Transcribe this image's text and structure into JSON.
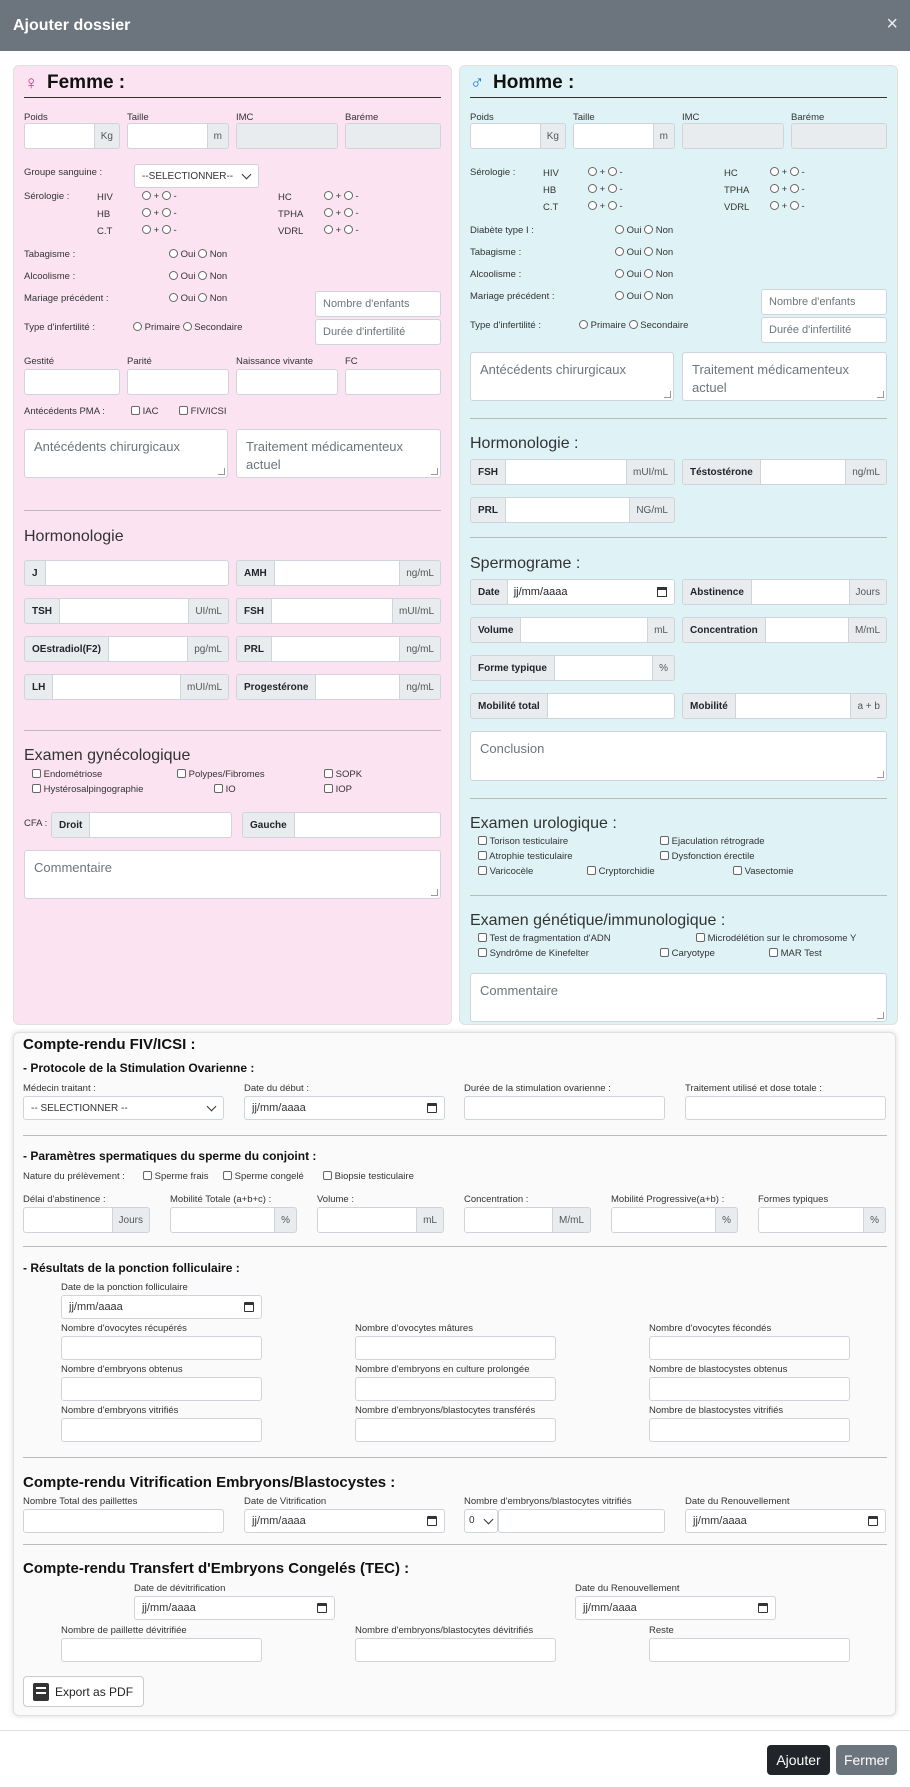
{
  "modal": {
    "title": "Ajouter dossier",
    "close_glyph": "×"
  },
  "footer": {
    "add": "Ajouter",
    "close": "Fermer"
  },
  "female": {
    "title": "Femme :",
    "symbol": "♀",
    "poids": "Poids",
    "taille": "Taille",
    "imc": "IMC",
    "bareme": "Baréme",
    "kg": "Kg",
    "m": "m",
    "groupe": "Groupe sanguine :",
    "groupe_select": "--SELECTIONNER--",
    "sero": "Sérologie :",
    "sero_items": [
      "HIV",
      "HB",
      "C.T",
      "HC",
      "TPHA",
      "VDRL"
    ],
    "plus": "+",
    "minus": "-",
    "tabac": "Tabagisme :",
    "alcool": "Alcoolisme :",
    "mariage": "Mariage précédent :",
    "oui": "Oui",
    "non": "Non",
    "nb_enfants": "Nombre d'enfants",
    "infert": "Type d'infertilité :",
    "primaire": "Primaire",
    "secondaire": "Secondaire",
    "duree_infert": "Durée d'infertilité",
    "gestite": "Gestité",
    "parite": "Parité",
    "naissance": "Naissance vivante",
    "fc": "FC",
    "atcd_pma": "Antécédents PMA :",
    "iac": "IAC",
    "fiv": "FIV/ICSI",
    "atcd_chir": "Antécédents chirurgicaux",
    "traitement": "Traitement médicamenteux actuel",
    "hormono": "Hormonologie",
    "h": {
      "j": "J",
      "amh": "AMH",
      "tsh": "TSH",
      "fsh": "FSH",
      "oe": "OEstradiol(F2)",
      "prl": "PRL",
      "lh": "LH",
      "proges": "Progestérone"
    },
    "u": {
      "ngml": "ng/mL",
      "uiml": "UI/mL",
      "muiml": "mUI/mL",
      "pgml": "pg/mL"
    },
    "exam": "Examen gynécologique",
    "exam_items": [
      "Endométriose",
      "Polypes/Fibromes",
      "SOPK",
      "Hystérosalpingographie",
      "IO",
      "IOP"
    ],
    "cfa": "CFA :",
    "droit": "Droit",
    "gauche": "Gauche",
    "comment": "Commentaire"
  },
  "male": {
    "title": "Homme :",
    "symbol": "♂",
    "poids": "Poids",
    "taille": "Taille",
    "imc": "IMC",
    "bareme": "Baréme",
    "kg": "Kg",
    "m": "m",
    "sero": "Sérologie :",
    "sero_items": [
      "HIV",
      "HB",
      "C.T",
      "HC",
      "TPHA",
      "VDRL"
    ],
    "plus": "+",
    "minus": "-",
    "diabete": "Diabète type I :",
    "tabac": "Tabagisme :",
    "alcool": "Alcoolisme :",
    "mariage": "Mariage précédent :",
    "oui": "Oui",
    "non": "Non",
    "nb_enfants": "Nombre d'enfants",
    "infert": "Type d'infertilité :",
    "primaire": "Primaire",
    "secondaire": "Secondaire",
    "duree_infert": "Durée d'infertilité",
    "atcd_chir": "Antécédents chirurgicaux",
    "traitement": "Traitement médicamenteux actuel",
    "hormono": "Hormonologie :",
    "h": {
      "fsh": "FSH",
      "testo": "Téstostérone",
      "prl": "PRL"
    },
    "u": {
      "muiml": "mUI/mL",
      "ngml": "ng/mL",
      "ngml2": "NG/mL",
      "jours": "Jours",
      "mml": "M/mL",
      "ml": "mL",
      "pct": "%",
      "ab": "a + b"
    },
    "spermo": "Spermograme :",
    "s": {
      "date": "Date",
      "date_ph": "jj/mm/aaaa",
      "abstinence": "Abstinence",
      "volume": "Volume",
      "concentration": "Concentration",
      "forme": "Forme typique",
      "mob_total": "Mobilité total",
      "mobilite": "Mobilité"
    },
    "conclusion": "Conclusion",
    "uro": "Examen urologique :",
    "uro_items": [
      "Torison testiculaire",
      "Ejaculation rétrograde",
      "Atrophie testiculaire",
      "Dysfonction érectile",
      "Varicocèle",
      "Cryptorchidie",
      "Vasectomie"
    ],
    "gen": "Examen génétique/immunologique :",
    "gen_items": [
      "Test de fragmentation d'ADN",
      "Microdélétion sur le chromosome Y",
      "Syndrôme de Kinefelter",
      "Caryotype",
      "MAR Test"
    ],
    "comment": "Commentaire"
  },
  "cr": {
    "title": "Compte-rendu FIV/ICSI :",
    "proto": "- Protocole de la Stimulation Ovarienne :",
    "medecin": "Médecin traitant :",
    "medecin_sel": "-- SELECTIONNER --",
    "date_debut": "Date du début :",
    "date_ph": "jj/mm/aaaa",
    "duree_stim": "Durée de la stimulation ovarienne :",
    "trait_dose": "Traitement utilisé et dose totale :",
    "params": "- Paramètres spermatiques du sperme du conjoint :",
    "nature": "Nature du prélèvement :",
    "frais": "Sperme frais",
    "congele": "Sperme congelé",
    "biopsie": "Biopsie testiculaire",
    "delai": "Délai d'abstinence :",
    "mob_tot": "Mobilité Totale (a+b+c) :",
    "volume": "Volume :",
    "conc": "Concentration :",
    "mob_prog": "Mobilité Progressive(a+b) :",
    "formes": "Formes typiques",
    "jours": "Jours",
    "pct": "%",
    "ml": "mL",
    "mml": "M/mL",
    "ponction": "- Résultats de la ponction folliculaire :",
    "date_ponction": "Date de la ponction folliculaire",
    "p": [
      "Nombre d'ovocytes récupérés",
      "Nombre d'ovocytes mâtures",
      "Nombre d'ovocytes fécondés",
      "Nombre d'embryons obtenus",
      "Nombre d'embryons en culture prolongée",
      "Nombre de blastocystes obtenus",
      "Nombre d'embryons vitrifiés",
      "Nombre d'embryons/blastocytes transférés",
      "Nombre de blastocystes vitrifiés"
    ],
    "vitri_title": "Compte-rendu Vitrification Embryons/Blastocystes :",
    "v": {
      "total": "Nombre Total des paillettes",
      "date_vitri": "Date de Vitrification",
      "nb_vitri": "Nombre d'embryons/blastocytes vitrifiés",
      "sel0": "0",
      "renouv": "Date du Renouvellement"
    },
    "tec_title": "Compte-rendu Transfert d'Embryons Congelés (TEC) :",
    "t": {
      "date_devitri": "Date de dévitrification",
      "renouv": "Date du Renouvellement",
      "nb_paillette": "Nombre de paillette dévitrifiée",
      "nb_devitri": "Nombre d'embryons/blastocytes dévitrifiés",
      "reste": "Reste"
    },
    "export": "Export as PDF"
  }
}
